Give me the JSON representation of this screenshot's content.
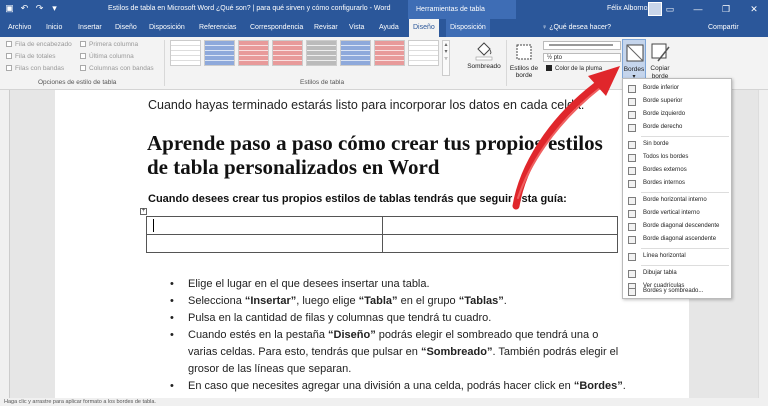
{
  "titlebar": {
    "doc_title": "Estilos de tabla en Microsoft Word ¿Qué son? | para qué sirven y cómo configurarlo  -  Word",
    "context_title": "Herramientas de tabla",
    "user": "Félix Albornoz",
    "window_buttons": [
      "▭",
      "—",
      "❐",
      "✕"
    ]
  },
  "tabs": [
    {
      "label": "Archivo"
    },
    {
      "label": "Inicio"
    },
    {
      "label": "Insertar"
    },
    {
      "label": "Diseño"
    },
    {
      "label": "Disposición"
    },
    {
      "label": "Referencias"
    },
    {
      "label": "Correspondencia"
    },
    {
      "label": "Revisar"
    },
    {
      "label": "Vista"
    },
    {
      "label": "Ayuda"
    },
    {
      "label": "Diseño"
    },
    {
      "label": "Disposición"
    }
  ],
  "tellme": "♀ ¿Qué desea hacer?",
  "share": "Compartir",
  "ribbon": {
    "options": {
      "header_row": "Fila de encabezado",
      "first_col": "Primera columna",
      "total_row": "Fila de totales",
      "last_col": "Última columna",
      "banded_rows": "Filas con bandas",
      "banded_cols": "Columnas con bandas",
      "group": "Opciones de estilo de tabla"
    },
    "styles_group": "Estilos de tabla",
    "shading": "Sombreado",
    "border_styles": "Estilos de borde",
    "line_weight": "½ pto",
    "pen_color": "Color de la pluma",
    "borders": "Bordes",
    "copy_format": "Copiar borde"
  },
  "document": {
    "intro": "Cuando hayas terminado estarás listo para incorporar los datos en cada celda.",
    "heading": "Aprende paso a paso cómo crear tus propios estilos de tabla personalizados en Word",
    "guide": "Cuando desees crear tus propios estilos de tablas tendrás que seguir esta guía:",
    "bullets": {
      "b1": "Elige el lugar en el que desees insertar una tabla.",
      "b2_a": "Selecciona ",
      "b2_b": "“Insertar”",
      "b2_c": ", luego elige ",
      "b2_d": "“Tabla”",
      "b2_e": " en el grupo ",
      "b2_f": "“Tablas”",
      "b2_g": ".",
      "b3": "Pulsa en la cantidad de filas y columnas que tendrá tu cuadro.",
      "b4_a": "Cuando estés en la pestaña ",
      "b4_b": "“Diseño”",
      "b4_c": " podrás elegir el sombreado que tendrá una o varias celdas. Para esto, tendrás que pulsar en ",
      "b4_d": "“Sombreado”",
      "b4_e": ". También podrás elegir el grosor de las líneas que separan.",
      "b5_a": "En caso que necesites agregar una división a una celda, podrás hacer click en ",
      "b5_b": "“Bordes”",
      "b5_c": "."
    }
  },
  "menu": {
    "items": [
      {
        "label": "Borde inferior",
        "icon": "border-bottom-icon"
      },
      {
        "label": "Borde superior",
        "icon": "border-top-icon"
      },
      {
        "label": "Borde izquierdo",
        "icon": "border-left-icon"
      },
      {
        "label": "Borde derecho",
        "icon": "border-right-icon"
      },
      {
        "label": "Sin borde",
        "icon": "no-border-icon"
      },
      {
        "label": "Todos los bordes",
        "icon": "all-borders-icon"
      },
      {
        "label": "Bordes externos",
        "icon": "outside-borders-icon"
      },
      {
        "label": "Bordes internos",
        "icon": "inside-borders-icon"
      },
      {
        "label": "Borde horizontal interno",
        "icon": "inside-horizontal-icon"
      },
      {
        "label": "Borde vertical interno",
        "icon": "inside-vertical-icon"
      },
      {
        "label": "Borde diagonal descendente",
        "icon": "diagonal-down-icon"
      },
      {
        "label": "Borde diagonal ascendente",
        "icon": "diagonal-up-icon"
      },
      {
        "label": "Línea horizontal",
        "icon": "horizontal-line-icon"
      },
      {
        "label": "Dibujar tabla",
        "icon": "draw-table-icon"
      },
      {
        "label": "Ver cuadrículas",
        "icon": "view-gridlines-icon"
      },
      {
        "label": "Bordes y sombreado...",
        "icon": "borders-shading-icon"
      }
    ]
  },
  "status": "Haga clic y arrastre para aplicar formato a los bordes de tabla.",
  "colors": {
    "word_blue": "#2b579a",
    "arrow_red": "#e0262b"
  }
}
